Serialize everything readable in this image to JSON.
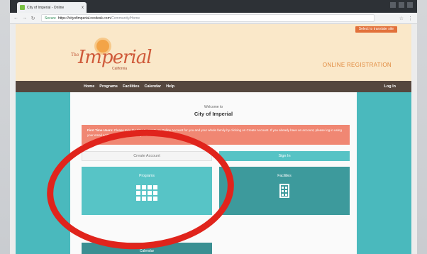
{
  "browser": {
    "tab_title": "City of Imperial - Online",
    "tab_close": "x",
    "url_secure": "Secure",
    "url_host": "https://cityofimperial.recdesk.com",
    "url_path": "/Community/Home"
  },
  "site": {
    "language_button": "Select to translate site",
    "logo_the": "The",
    "logo_name": "Imperial",
    "logo_city": "California",
    "tagline": "ONLINE REGISTRATION",
    "nav": [
      "Home",
      "Programs",
      "Facilities",
      "Calendar",
      "Help"
    ],
    "login": "Log In",
    "welcome": "Welcome to",
    "city_name": "City of Imperial",
    "alert_bold": "First Time Users:",
    "alert_text": "Please take the time to create an Online Account for you and your whole family by clicking on Create Account. If you already have an account, please log in using your email address as username and password.",
    "create_account": "Create Account",
    "sign_in": "Sign In",
    "programs_label": "Programs",
    "facilities_label": "Facilities",
    "calendar_label": "Calendar"
  },
  "colors": {
    "teal": "#4ab9bd",
    "header_bg": "#fae8c9",
    "nav_bg": "#55473e",
    "alert_bg": "#f08773",
    "annotation_red": "#e0241c"
  }
}
